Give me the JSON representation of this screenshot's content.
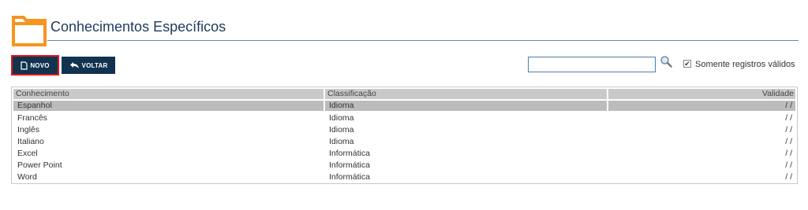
{
  "header": {
    "title": "Conhecimentos Específicos",
    "icon": "folder-icon",
    "accent_color": "#f7941d"
  },
  "toolbar": {
    "new_label": "NOVO",
    "back_label": "VOLTAR",
    "search_value": "",
    "search_placeholder": "",
    "only_valid_label": "Somente registros válidos",
    "only_valid_checked": true
  },
  "table": {
    "columns": [
      "Conhecimento",
      "Classificação",
      "Validade"
    ],
    "rows": [
      {
        "conhecimento": "Espanhol",
        "classificacao": "Idioma",
        "validade": "/ /",
        "selected": true
      },
      {
        "conhecimento": "Francês",
        "classificacao": "Idioma",
        "validade": "/ /"
      },
      {
        "conhecimento": "Inglês",
        "classificacao": "Idioma",
        "validade": "/ /"
      },
      {
        "conhecimento": "Italiano",
        "classificacao": "Idioma",
        "validade": "/ /"
      },
      {
        "conhecimento": "Excel",
        "classificacao": "Informática",
        "validade": "/ /"
      },
      {
        "conhecimento": "Power Point",
        "classificacao": "Informática",
        "validade": "/ /"
      },
      {
        "conhecimento": "Word",
        "classificacao": "Informática",
        "validade": "/ /"
      }
    ]
  }
}
